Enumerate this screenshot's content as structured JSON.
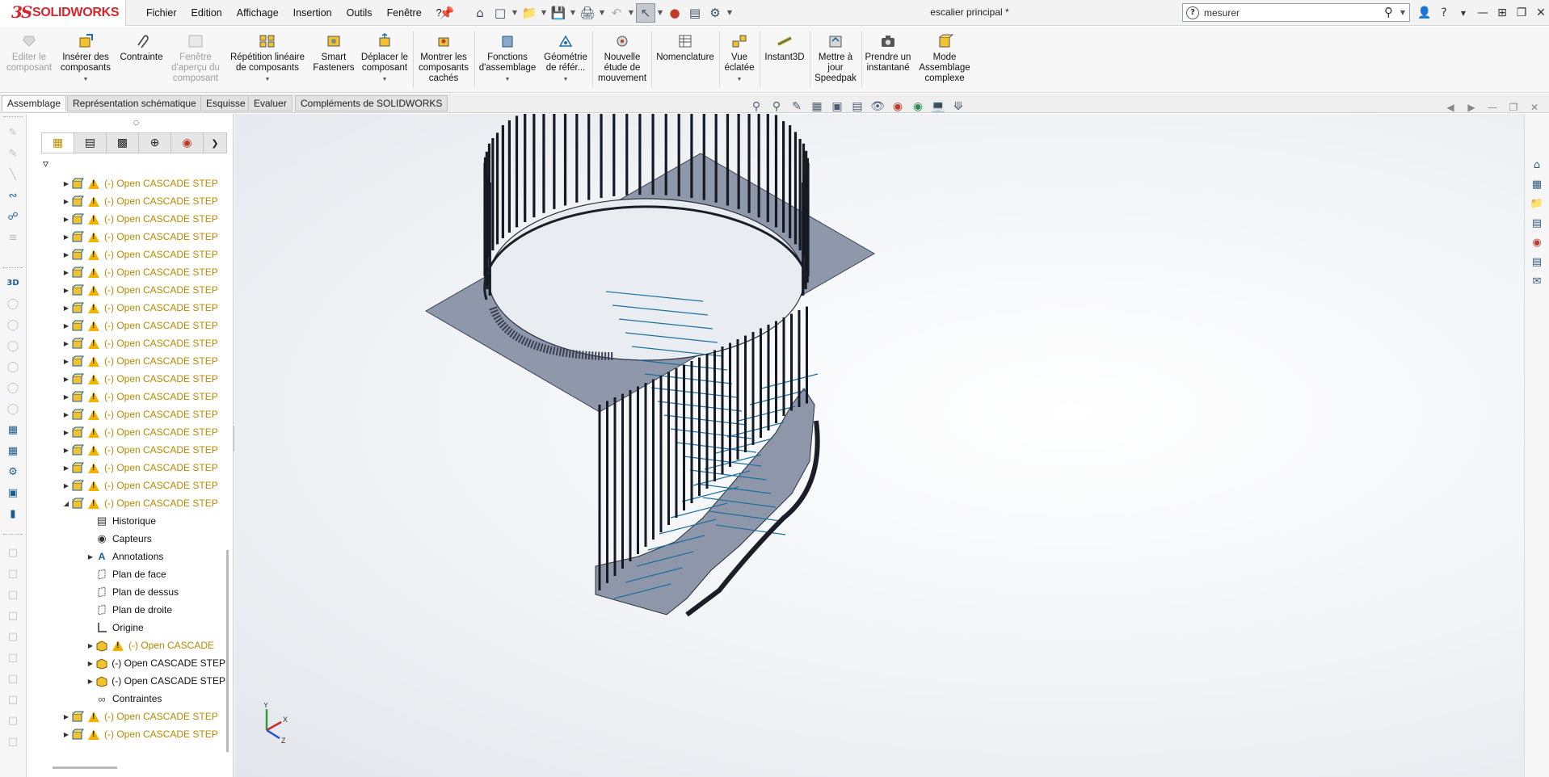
{
  "app": {
    "logo_ds": "3S",
    "logo_name": "SOLIDWORKS",
    "document_title": "escalier principal *"
  },
  "menu": [
    "Fichier",
    "Edition",
    "Affichage",
    "Insertion",
    "Outils",
    "Fenêtre",
    "?"
  ],
  "search": {
    "value": "mesurer",
    "placeholder": "mesurer"
  },
  "commands": [
    {
      "id": "edit-component",
      "label": "Editer le composant",
      "disabled": true
    },
    {
      "id": "insert-components",
      "label": "Insérer des composants",
      "disabled": false
    },
    {
      "id": "mate",
      "label": "Contrainte",
      "disabled": false
    },
    {
      "id": "component-preview",
      "label": "Fenêtre d'aperçu du composant",
      "disabled": true
    },
    {
      "id": "linear-pattern",
      "label": "Répétition linéaire de composants",
      "disabled": false
    },
    {
      "id": "smart-fasteners",
      "label": "Smart Fasteners",
      "disabled": false
    },
    {
      "id": "move-component",
      "label": "Déplacer le composant",
      "disabled": false
    },
    {
      "id": "show-hidden",
      "label": "Montrer les composants cachés",
      "disabled": false
    },
    {
      "id": "assembly-features",
      "label": "Fonctions d'assemblage",
      "disabled": false
    },
    {
      "id": "reference-geometry",
      "label": "Géométrie de référ...",
      "disabled": false
    },
    {
      "id": "motion-study",
      "label": "Nouvelle étude de mouvement",
      "disabled": false
    },
    {
      "id": "bom",
      "label": "Nomenclature",
      "disabled": false
    },
    {
      "id": "exploded-view",
      "label": "Vue éclatée",
      "disabled": false
    },
    {
      "id": "instant3d",
      "label": "Instant3D",
      "disabled": false
    },
    {
      "id": "speedpak",
      "label": "Mettre à jour Speedpak",
      "disabled": false
    },
    {
      "id": "snapshot",
      "label": "Prendre un instantané",
      "disabled": false
    },
    {
      "id": "large-assembly",
      "label": "Mode Assemblage complexe",
      "disabled": false
    }
  ],
  "tabs": [
    "Assemblage",
    "Représentation schématique",
    "Esquisse",
    "Evaluer",
    "Compléments de SOLIDWORKS"
  ],
  "active_tab": "Assemblage",
  "tree": {
    "component_label": "(-) Open CASCADE STEP",
    "sub_component_truncated": "(-) Open CASCADE",
    "history": "Historique",
    "sensors": "Capteurs",
    "annotations": "Annotations",
    "front_plane": "Plan de face",
    "top_plane": "Plan de dessus",
    "right_plane": "Plan de droite",
    "origin": "Origine",
    "mates": "Contraintes"
  },
  "triad": {
    "x": "X",
    "y": "Y",
    "z": "Z"
  },
  "colors": {
    "brand": "#d6262b",
    "warning": "#f0b400",
    "warning_text": "#b58a00",
    "model_steel": "#8e96aa",
    "model_edges": "#1f6f9f"
  }
}
